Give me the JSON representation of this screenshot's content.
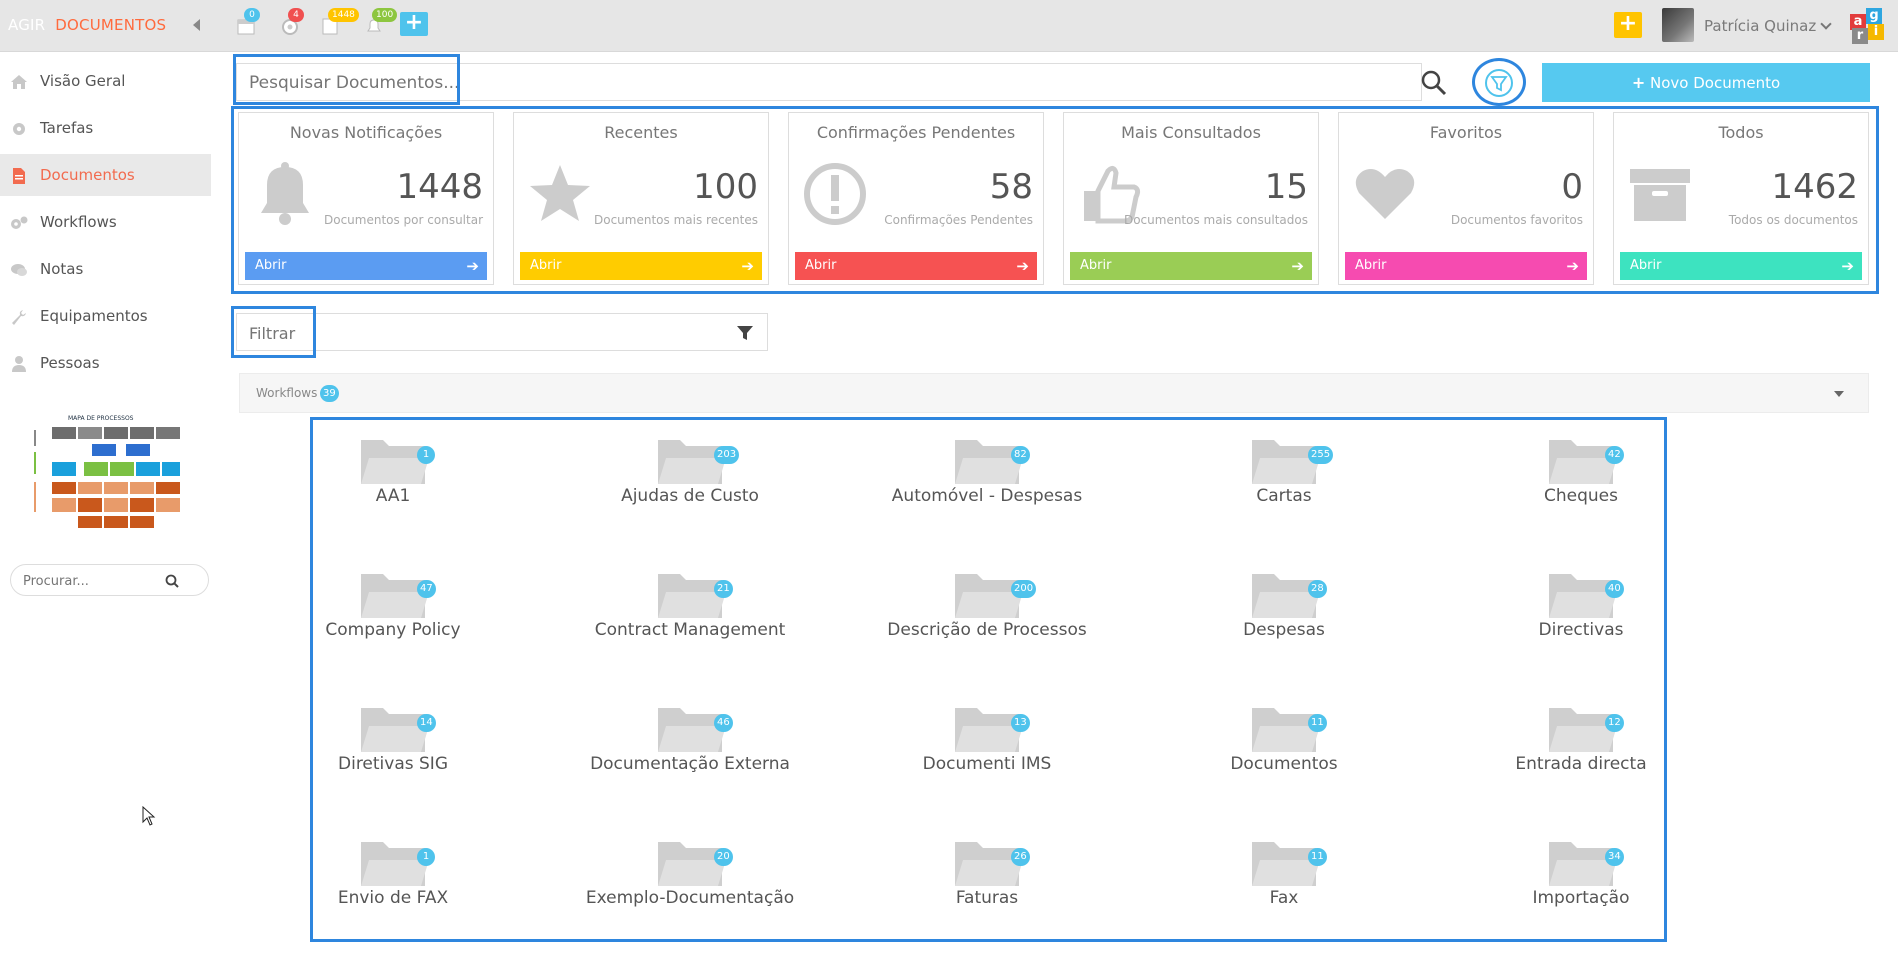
{
  "topbar": {
    "brand_left": "AGIR",
    "brand_right": "DOCUMENTOS",
    "icons": [
      {
        "name": "calendar-icon",
        "badge": "0",
        "badge_color": "#4fc3ec"
      },
      {
        "name": "gear-icon",
        "badge": "4",
        "badge_color": "#f05050"
      },
      {
        "name": "document-icon",
        "badge": "1448",
        "badge_color": "#ffc400"
      },
      {
        "name": "bell-icon",
        "badge": "100",
        "badge_color": "#8dc63f"
      }
    ],
    "add_label": "+",
    "quick_add_label": "+",
    "user_name": "Patrícia Quinaz",
    "logo_letters": [
      "a",
      "g",
      "r",
      "i"
    ]
  },
  "sidebar": {
    "items": [
      {
        "label": "Visão Geral",
        "icon": "home-icon"
      },
      {
        "label": "Tarefas",
        "icon": "gear-icon"
      },
      {
        "label": "Documentos",
        "icon": "document-icon",
        "active": true
      },
      {
        "label": "Workflows",
        "icon": "gears-icon"
      },
      {
        "label": "Notas",
        "icon": "chat-icon"
      },
      {
        "label": "Equipamentos",
        "icon": "wrench-icon"
      },
      {
        "label": "Pessoas",
        "icon": "person-icon"
      }
    ],
    "thumb_title": "MAPA DE PROCESSOS",
    "search_placeholder": "Procurar..."
  },
  "main": {
    "search_placeholder": "Pesquisar Documentos...",
    "new_doc_label": "Novo Documento",
    "cards": [
      {
        "title": "Novas Notificações",
        "value": "1448",
        "sub": "Documentos por consultar",
        "button": "Abrir",
        "color": "#5b9cf2",
        "icon": "bell-icon"
      },
      {
        "title": "Recentes",
        "value": "100",
        "sub": "Documentos mais recentes",
        "button": "Abrir",
        "color": "#ffcc00",
        "icon": "star-icon"
      },
      {
        "title": "Confirmações Pendentes",
        "value": "58",
        "sub": "Confirmações Pendentes",
        "button": "Abrir",
        "color": "#f65252",
        "icon": "exclamation-icon"
      },
      {
        "title": "Mais Consultados",
        "value": "15",
        "sub": "Documentos mais consultados",
        "button": "Abrir",
        "color": "#9acd55",
        "icon": "thumbs-up-icon"
      },
      {
        "title": "Favoritos",
        "value": "0",
        "sub": "Documentos favoritos",
        "button": "Abrir",
        "color": "#f64bb0",
        "icon": "heart-icon"
      },
      {
        "title": "Todos",
        "value": "1462",
        "sub": "Todos os documentos",
        "button": "Abrir",
        "color": "#3de3c0",
        "icon": "archive-icon"
      }
    ],
    "filter_placeholder": "Filtrar",
    "workflows_label": "Workflows",
    "workflows_count": "39",
    "folders": [
      {
        "name": "AA1",
        "count": "1"
      },
      {
        "name": "Ajudas de Custo",
        "count": "203"
      },
      {
        "name": "Automóvel - Despesas",
        "count": "82"
      },
      {
        "name": "Cartas",
        "count": "255"
      },
      {
        "name": "Cheques",
        "count": "42"
      },
      {
        "name": "Company Policy",
        "count": "47"
      },
      {
        "name": "Contract Management",
        "count": "21"
      },
      {
        "name": "Descrição de Processos",
        "count": "200"
      },
      {
        "name": "Despesas",
        "count": "28"
      },
      {
        "name": "Directivas",
        "count": "40"
      },
      {
        "name": "Diretivas SIG",
        "count": "14"
      },
      {
        "name": "Documentação Externa",
        "count": "46"
      },
      {
        "name": "Documenti IMS",
        "count": "13"
      },
      {
        "name": "Documentos",
        "count": "11"
      },
      {
        "name": "Entrada directa",
        "count": "12"
      },
      {
        "name": "Envio de FAX",
        "count": "1"
      },
      {
        "name": "Exemplo-Documentação",
        "count": "20"
      },
      {
        "name": "Faturas",
        "count": "26"
      },
      {
        "name": "Fax",
        "count": "11"
      },
      {
        "name": "Importação",
        "count": "34"
      }
    ]
  }
}
